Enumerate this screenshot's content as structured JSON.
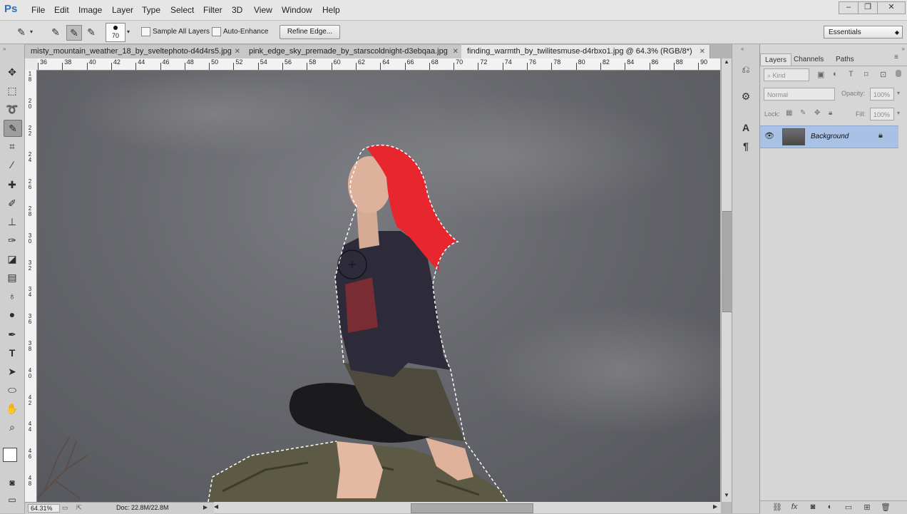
{
  "app": {
    "logo": "Ps",
    "menu": [
      "File",
      "Edit",
      "Image",
      "Layer",
      "Type",
      "Select",
      "Filter",
      "3D",
      "View",
      "Window",
      "Help"
    ]
  },
  "window_controls": {
    "minimize": "–",
    "restore": "❐",
    "close": "✕"
  },
  "options_bar": {
    "brush_size": "70",
    "sample_all_layers_label": "Sample All Layers",
    "auto_enhance_label": "Auto-Enhance",
    "refine_edge_label": "Refine Edge...",
    "workspace_value": "Essentials"
  },
  "tabs": [
    {
      "label": "misty_mountain_weather_18_by_sveltephoto-d4d4rs5.jpg",
      "close": "✕"
    },
    {
      "label": "pink_edge_sky_premade_by_starscoldnight-d3ebqaa.jpg",
      "close": "✕"
    },
    {
      "label": "finding_warmth_by_twilitesmuse-d4rbxo1.jpg @ 64.3% (RGB/8*)",
      "close": "✕"
    }
  ],
  "hruler_labels": [
    "36",
    "38",
    "40",
    "42",
    "44",
    "46",
    "48",
    "50",
    "52",
    "54",
    "56",
    "58",
    "60",
    "62",
    "64",
    "66",
    "68",
    "70",
    "72",
    "74",
    "76",
    "78",
    "80",
    "82",
    "84",
    "86",
    "88",
    "90"
  ],
  "vruler_labels": [
    "18",
    "20",
    "22",
    "24",
    "26",
    "28",
    "30",
    "32",
    "34",
    "36",
    "38",
    "40",
    "42",
    "44",
    "46",
    "48"
  ],
  "status_bar": {
    "zoom": "64.31%",
    "doc": "Doc: 22.8M/22.8M"
  },
  "layers_panel": {
    "tabs": [
      "Layers",
      "Channels",
      "Paths"
    ],
    "filter_kind": "Kind",
    "blend_mode": "Normal",
    "opacity_label": "Opacity:",
    "opacity_value": "100%",
    "lock_label": "Lock:",
    "fill_label": "Fill:",
    "fill_value": "100%",
    "layers": [
      {
        "name": "Background",
        "visible": true,
        "locked": true
      }
    ],
    "bottom_icons": [
      "link-icon",
      "fx-icon",
      "mask-icon",
      "adjustment-icon",
      "group-icon",
      "new-layer-icon",
      "trash-icon"
    ]
  },
  "colors": {
    "selection_row": "#aac1e6",
    "hair": "#e8262e",
    "canvas_sky": "#66676c"
  }
}
